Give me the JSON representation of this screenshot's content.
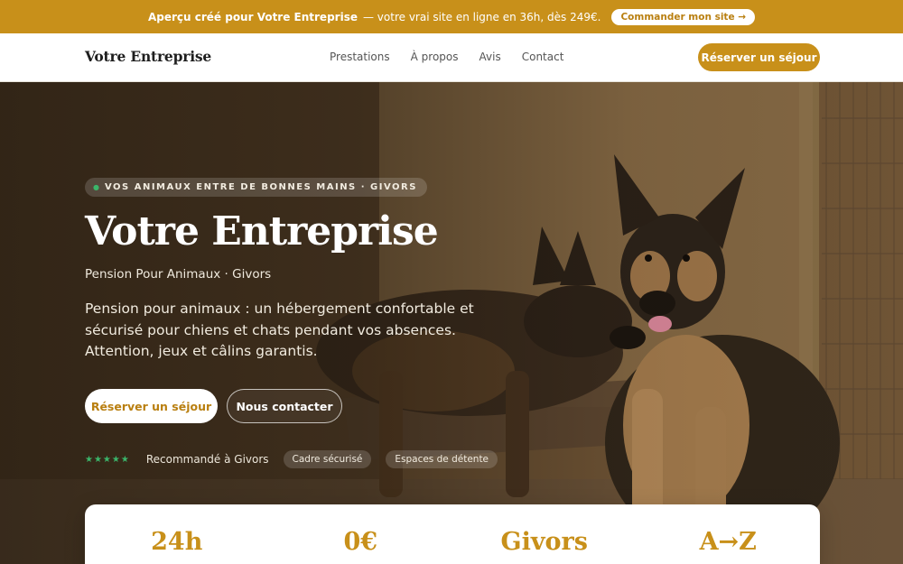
{
  "promo": {
    "strong": "Aperçu créé pour Votre Entreprise",
    "text": "— votre vrai site en ligne en 36h, dès 249€.",
    "button": "Commander mon site →"
  },
  "nav": {
    "brand": "Votre Entreprise",
    "links": [
      "Prestations",
      "À propos",
      "Avis",
      "Contact"
    ],
    "cta": "Réserver un séjour"
  },
  "hero": {
    "tag": "VOS ANIMAUX ENTRE DE BONNES MAINS · GIVORS",
    "title": "Votre Entreprise",
    "subtitle": "Pension Pour Animaux · Givors",
    "description": "Pension pour animaux : un hébergement confortable et sécurisé pour chiens et chats pendant vos absences. Attention, jeux et câlins garantis.",
    "primary_button": "Réserver un séjour",
    "secondary_button": "Nous contacter",
    "rating_stars": "★★★★★",
    "recommended": "Recommandé à Givors",
    "chips": [
      "Cadre sécurisé",
      "Espaces de détente"
    ]
  },
  "stats": [
    "24h",
    "0€",
    "Givors",
    "A→Z"
  ],
  "colors": {
    "accent": "#c8901a",
    "star": "#3bb56a"
  }
}
